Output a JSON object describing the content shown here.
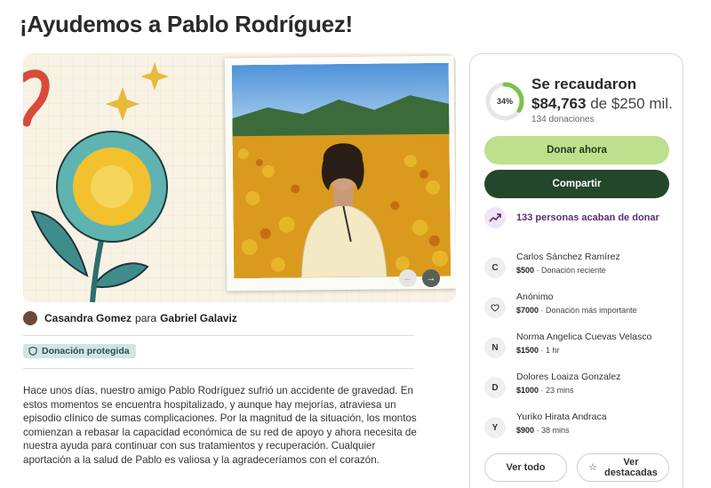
{
  "page": {
    "title": "¡Ayudemos a Pablo Rodríguez!"
  },
  "organizer": {
    "name": "Casandra Gomez",
    "connector": "para",
    "beneficiary": "Gabriel Galaviz",
    "badge": "Donación protegida"
  },
  "story": "Hace unos días, nuestro amigo Pablo Rodríguez sufrió un accidente de gravedad. En estos momentos se encuentra hospitalizado, y aunque hay mejorías, atraviesa un episodio clínico de sumas complicaciones. Por la magnitud de la situación, los montos comienzan a rebasar la capacidad económica de su red de apoyo y ahora necesita de nuestra ayuda para continuar con sus tratamientos y recuperación. Cualquier aportación a la salud de Pablo es valiosa y la agradeceríamos con el corazón.",
  "progress": {
    "percent_label": "34%",
    "fraction": 0.34,
    "heading": "Se recaudaron",
    "amount": "$84,763",
    "goal_text": "de $250 mil.",
    "donations": "134 donaciones"
  },
  "actions": {
    "donate": "Donar ahora",
    "share": "Compartir",
    "see_all": "Ver todo",
    "see_top_line1": "Ver",
    "see_top_line2": "destacadas"
  },
  "recent": {
    "text": "133 personas acaban de donar"
  },
  "donors": [
    {
      "initial": "C",
      "name": "Carlos Sánchez Ramírez",
      "amount": "$500",
      "detail": "· Donación reciente"
    },
    {
      "initial": "",
      "icon": "heart-hands-icon",
      "name": "Anónimo",
      "amount": "$7000",
      "detail": "· Donación más importante"
    },
    {
      "initial": "N",
      "name": "Norma Angelica Cuevas Velasco",
      "amount": "$1500",
      "detail": "· 1 hr"
    },
    {
      "initial": "D",
      "name": "Dolores Loaiza Gonzalez",
      "amount": "$1000",
      "detail": "· 23 mins"
    },
    {
      "initial": "Y",
      "name": "Yuriko Hirata Andraca",
      "amount": "$900",
      "detail": "· 38 mins"
    }
  ],
  "colors": {
    "donate_button": "#bde08f",
    "share_button": "#23472a",
    "progress_ring": "#7cc24e",
    "recent_text": "#5b2e73",
    "badge_bg": "#cfe6e3"
  }
}
